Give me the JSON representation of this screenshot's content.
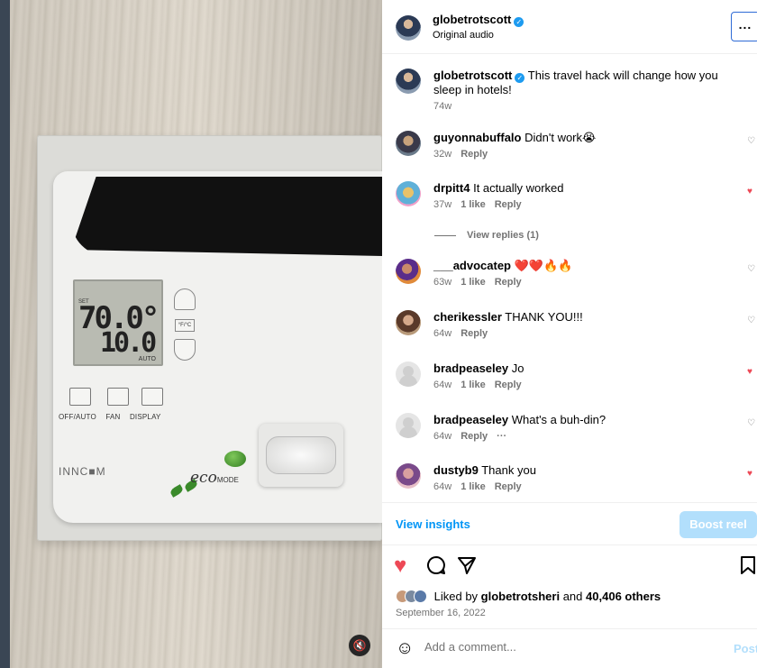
{
  "video": {
    "lcd_set": "SET",
    "lcd_temp_main": "70.0°",
    "lcd_temp_sub": "10.0",
    "lcd_auto": "AUTO",
    "fc_label": "°F/°C",
    "labels": [
      "OFF/AUTO",
      "FAN",
      "DISPLAY"
    ],
    "brand": "INNC■M",
    "eco_label": "eco",
    "eco_mode": "MODE",
    "mute_icon": "speaker-muted-icon"
  },
  "header": {
    "username": "globetrotscott",
    "subtitle": "Original audio",
    "more_label": "..."
  },
  "caption": {
    "username": "globetrotscott",
    "text": "This travel hack will change how you sleep in hotels!",
    "time": "74w"
  },
  "comments": [
    {
      "username": "guyonnabuffalo",
      "text": "Didn't work😭",
      "time": "32w",
      "likes": "",
      "reply": "Reply",
      "liked": false
    },
    {
      "username": "drpitt4",
      "text": "It actually worked",
      "time": "37w",
      "likes": "1 like",
      "reply": "Reply",
      "liked": true
    },
    {
      "username": "___advocatep",
      "text": "❤️❤️🔥🔥",
      "time": "63w",
      "likes": "1 like",
      "reply": "Reply",
      "liked": false
    },
    {
      "username": "cherikessler",
      "text": "THANK YOU!!!",
      "time": "64w",
      "likes": "",
      "reply": "Reply",
      "liked": false
    },
    {
      "username": "bradpeaseley",
      "text": "Jo",
      "time": "64w",
      "likes": "1 like",
      "reply": "Reply",
      "liked": true
    },
    {
      "username": "bradpeaseley",
      "text": "What's a buh-din?",
      "time": "64w",
      "likes": "",
      "reply": "Reply",
      "more": "···",
      "liked": false
    },
    {
      "username": "dustyb9",
      "text": "Thank you",
      "time": "64w",
      "likes": "1 like",
      "reply": "Reply",
      "liked": true
    }
  ],
  "view_replies": "View replies (1)",
  "insights": {
    "view_label": "View insights",
    "boost_label": "Boost reel"
  },
  "likes": {
    "prefix": "Liked by",
    "user": "globetrotsheri",
    "and": "and",
    "others": "40,406 others",
    "date": "September 16, 2022"
  },
  "comment_box": {
    "placeholder": "Add a comment...",
    "post_label": "Post"
  },
  "colors": {
    "accent": "#0095f6",
    "accent_disabled": "#b2dffc",
    "heart": "#ed4956",
    "muted_text": "#737373"
  }
}
